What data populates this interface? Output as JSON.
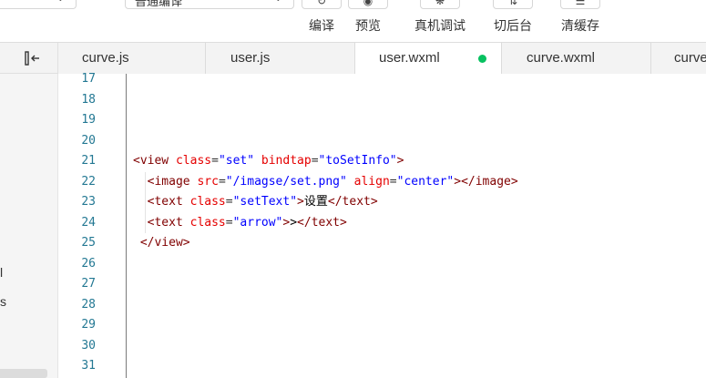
{
  "toolbar": {
    "compile_mode": "普通编译",
    "buttons": {
      "compile": "编译",
      "preview": "预览",
      "debug": "真机调试",
      "background": "切后台",
      "clear_cache": "清缓存"
    }
  },
  "tabs": [
    {
      "label": "curve.js",
      "active": false
    },
    {
      "label": "user.js",
      "active": false
    },
    {
      "label": "user.wxml",
      "active": true,
      "status_dot_color": "#07c160"
    },
    {
      "label": "curve.wxml",
      "active": false
    },
    {
      "label": "curve",
      "active": false
    }
  ],
  "left_panel": {
    "fragments": [
      "l",
      "s"
    ]
  },
  "editor": {
    "lines": [
      {
        "num": "17"
      },
      {
        "num": "18"
      },
      {
        "num": "19"
      },
      {
        "num": "20"
      },
      {
        "num": "21",
        "tokens": {
          "open": "<",
          "tag": "view",
          "sp1": " ",
          "a1": "class",
          "eq1": "=",
          "v1": "\"set\"",
          "sp2": " ",
          "a2": "bindtap",
          "eq2": "=",
          "v2": "\"toSetInfo\"",
          "close": ">"
        }
      },
      {
        "num": "22",
        "tokens": {
          "indent": "  ",
          "open": "<",
          "tag": "image",
          "sp1": " ",
          "a1": "src",
          "eq1": "=",
          "v1": "\"/imagse/set.png\"",
          "sp2": " ",
          "a2": "align",
          "eq2": "=",
          "v2": "\"center\"",
          "close": "></",
          "tag2": "image",
          "close2": ">"
        }
      },
      {
        "num": "23",
        "tokens": {
          "indent": "  ",
          "open": "<",
          "tag": "text",
          "sp1": " ",
          "a1": "class",
          "eq1": "=",
          "v1": "\"setText\"",
          "close": ">",
          "text": "设置",
          "open2": "</",
          "tag2": "text",
          "close2": ">"
        }
      },
      {
        "num": "24",
        "tokens": {
          "indent": "  ",
          "open": "<",
          "tag": "text",
          "sp1": " ",
          "a1": "class",
          "eq1": "=",
          "v1": "\"arrow\"",
          "close": ">",
          "text": ">",
          "open2": "</",
          "tag2": "text",
          "close2": ">"
        }
      },
      {
        "num": "25",
        "tokens": {
          "indent": " ",
          "open": "</",
          "tag": "view",
          "close": ">"
        }
      },
      {
        "num": "26"
      },
      {
        "num": "27"
      },
      {
        "num": "28"
      },
      {
        "num": "29"
      },
      {
        "num": "30"
      },
      {
        "num": "31"
      }
    ]
  },
  "colors": {
    "line_number": "#237893",
    "tag": "#800000",
    "attribute": "#e50000",
    "string": "#0000ff",
    "modified_dot": "#07c160"
  }
}
